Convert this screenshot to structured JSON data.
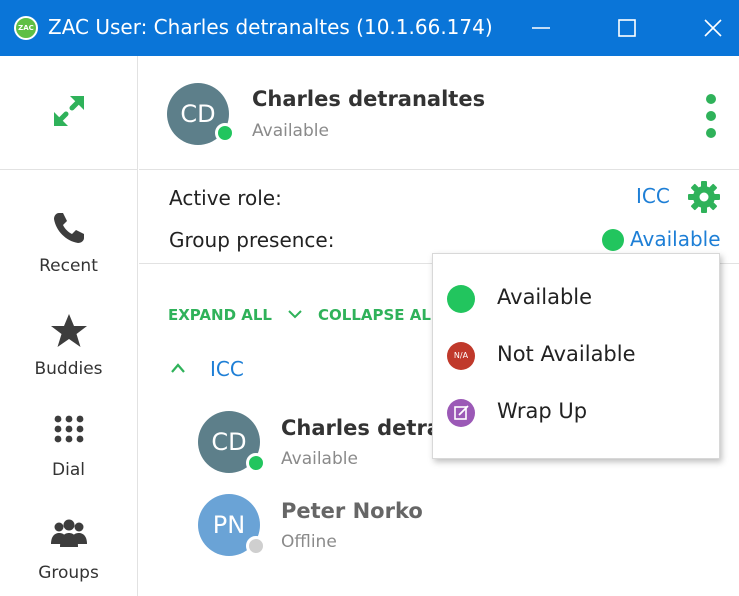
{
  "window": {
    "title": "ZAC User: Charles detranaltes (10.1.66.174)",
    "logo_text": "ZAC",
    "minimize_icon": "minimize-icon",
    "maximize_icon": "maximize-icon",
    "close_icon": "close-icon"
  },
  "sidebar": {
    "expand_icon": "expand-arrows-icon",
    "items": [
      {
        "label": "Recent",
        "icon": "phone-icon"
      },
      {
        "label": "Buddies",
        "icon": "star-icon"
      },
      {
        "label": "Dial",
        "icon": "dialpad-icon"
      },
      {
        "label": "Groups",
        "icon": "groups-icon"
      }
    ]
  },
  "header": {
    "avatar_initials": "CD",
    "user_name": "Charles detranaltes",
    "user_status": "Available",
    "menu_icon": "kebab-menu-icon"
  },
  "role": {
    "active_role_label": "Active role:",
    "active_role_value": "ICC",
    "settings_icon": "gear-icon",
    "group_presence_label": "Group presence:",
    "group_presence_value": "Available"
  },
  "list_controls": {
    "expand_all": "EXPAND ALL",
    "collapse_all": "COLLAPSE AL"
  },
  "group": {
    "name": "ICC",
    "buddies": [
      {
        "initials": "CD",
        "name": "Charles detra",
        "status": "Available"
      },
      {
        "initials": "PN",
        "name": "Peter Norko",
        "status": "Offline"
      }
    ]
  },
  "presence_menu": {
    "items": [
      {
        "label": "Available",
        "icon": "available-dot-icon"
      },
      {
        "label": "Not Available",
        "icon": "not-available-icon",
        "icon_text": "N/A"
      },
      {
        "label": "Wrap Up",
        "icon": "wrap-up-icon"
      }
    ]
  },
  "colors": {
    "titlebar": "#0a75d8",
    "accent_green": "#2fb25a",
    "link_blue": "#1e7fd6",
    "available": "#22c55e",
    "not_available": "#c0392b",
    "wrap_up": "#9b59b6"
  }
}
